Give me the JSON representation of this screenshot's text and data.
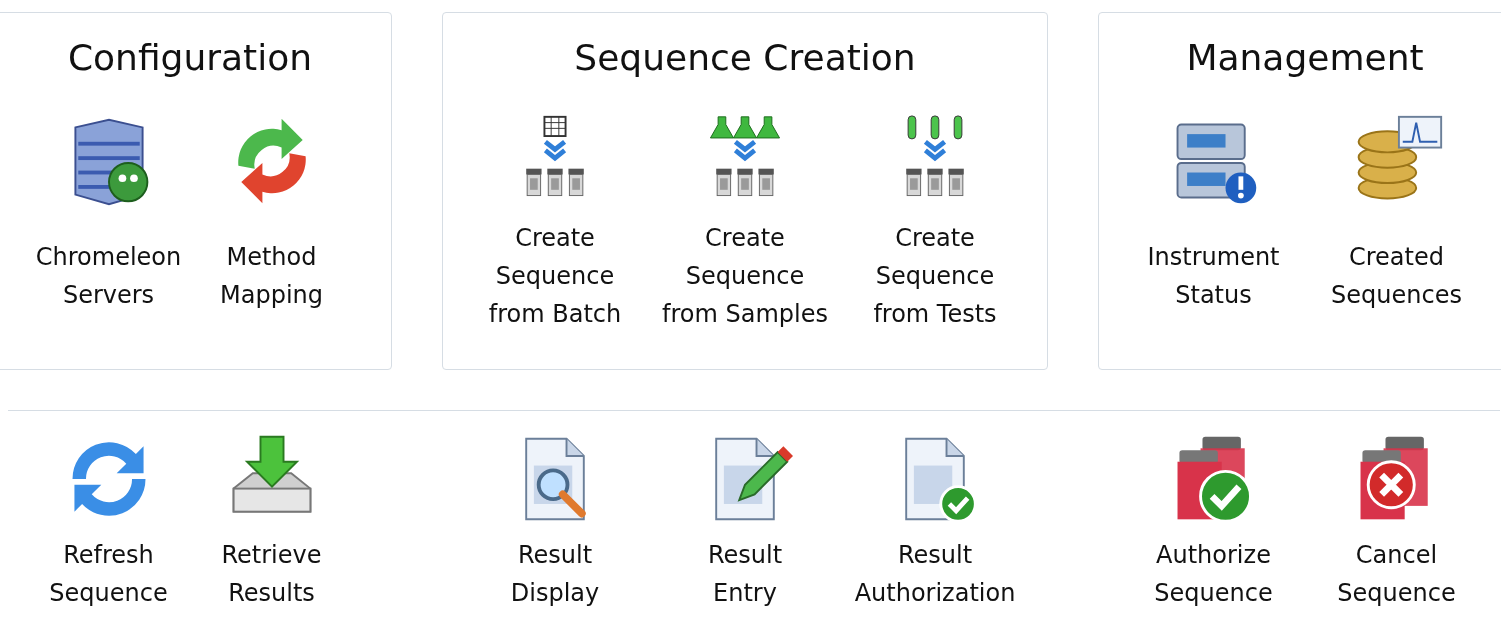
{
  "panels": [
    {
      "title": "Configuration",
      "items": [
        {
          "label": "Chromeleon\nServers"
        },
        {
          "label": "Method\nMapping"
        }
      ]
    },
    {
      "title": "Sequence Creation",
      "items": [
        {
          "label": "Create\nSequence\nfrom Batch"
        },
        {
          "label": "Create\nSequence\nfrom Samples"
        },
        {
          "label": "Create\nSequence\nfrom Tests"
        }
      ]
    },
    {
      "title": "Management",
      "items": [
        {
          "label": "Instrument\nStatus"
        },
        {
          "label": "Created\nSequences"
        }
      ]
    }
  ],
  "actions": [
    {
      "items": [
        {
          "label": "Refresh\nSequence"
        },
        {
          "label": "Retrieve\nResults"
        }
      ]
    },
    {
      "items": [
        {
          "label": "Result\nDisplay"
        },
        {
          "label": "Result\nEntry"
        },
        {
          "label": "Result\nAuthorization"
        }
      ]
    },
    {
      "items": [
        {
          "label": "Authorize\nSequence"
        },
        {
          "label": "Cancel\nSequence"
        }
      ]
    }
  ]
}
